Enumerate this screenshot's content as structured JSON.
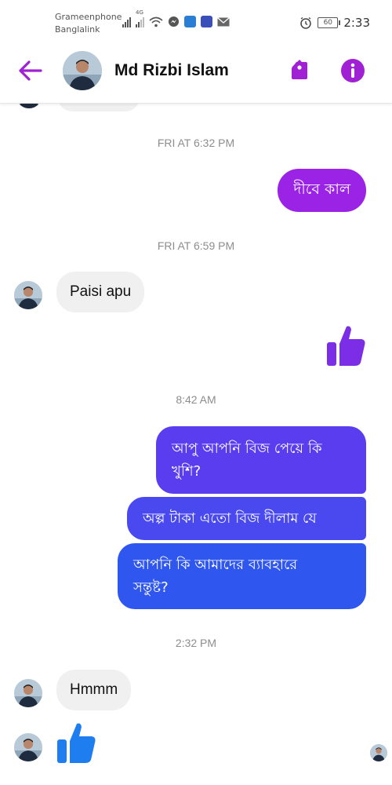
{
  "status_bar": {
    "carrier_1": "Grameenphone",
    "carrier_2": "Banglalink",
    "network": "4G",
    "battery": "60",
    "time": "2:33"
  },
  "header": {
    "contact_name": "Md Rizbi Islam",
    "icons": [
      "back-arrow-icon",
      "tag-icon",
      "info-icon"
    ],
    "accent": "#a020d4"
  },
  "messages": {
    "ts1": "FRI AT 6:32 PM",
    "m1": "দীবে কাল",
    "ts2": "FRI AT 6:59 PM",
    "m2": "Paisi apu",
    "ts3": "8:42 AM",
    "m4_line1": "আপু আপনি বিজ পেয়ে কি",
    "m4_line2": "খুশি?",
    "m5": "অল্প টাকা এতো বিজ দীলাম যে",
    "m6_line1": "আপনি কি আমাদের ব্যাবহারে",
    "m6_line2": "সন্তুষ্ট?",
    "ts4": "2:32 PM",
    "m7": "Hmmm"
  },
  "colors": {
    "purple_bubble": "#9b23e6",
    "blue_bubble_top": "#5b3df0",
    "blue_bubble_bottom": "#2b5bef",
    "incoming_bubble": "#f1f0f0",
    "like_sent": "#7c2ee6",
    "like_received": "#1e7ef0"
  }
}
